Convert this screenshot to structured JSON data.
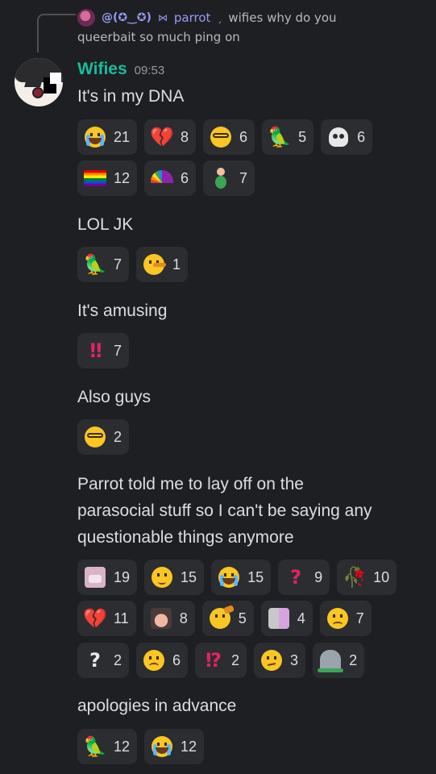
{
  "reply": {
    "author_handle": "@(✪‿✪)",
    "separator": "⋈",
    "second_name": "parrot",
    "comma": "ˏ",
    "preview_text_line1": "wifies why do you",
    "preview_text_line2": "queerbait so much ping on"
  },
  "message": {
    "username": "Wifies",
    "username_color": "#1abc9c",
    "timestamp": "09:53"
  },
  "blocks": [
    {
      "text": "It's in my DNA",
      "reactions": [
        [
          {
            "icon": "sob-emoji",
            "count": "21"
          },
          {
            "icon": "broken-heart-emoji",
            "count": "8"
          },
          {
            "icon": "nerd-face-emoji",
            "count": "6"
          },
          {
            "icon": "parrot-emoji",
            "count": "5"
          },
          {
            "icon": "skull-emoji",
            "count": "6"
          }
        ],
        [
          {
            "icon": "rainbow-flag-emoji",
            "count": "12"
          },
          {
            "icon": "rainbow-emoji",
            "count": "6"
          },
          {
            "icon": "pregnant-person-emoji",
            "count": "7"
          }
        ]
      ]
    },
    {
      "text": "LOL JK",
      "reactions": [
        [
          {
            "icon": "parrot-emoji",
            "count": "7"
          },
          {
            "icon": "lying-face-emoji",
            "count": "1"
          }
        ]
      ]
    },
    {
      "text": "It's amusing",
      "reactions": [
        [
          {
            "icon": "double-exclamation-emoji",
            "count": "7"
          }
        ]
      ]
    },
    {
      "text": "Also guys",
      "reactions": [
        [
          {
            "icon": "nerd-face-emoji",
            "count": "2"
          }
        ]
      ]
    },
    {
      "text_lines": [
        "Parrot told me to lay off on the",
        "parasocial stuff so I can't be saying any",
        "questionable things anymore"
      ],
      "reactions": [
        [
          {
            "icon": "angry-custom-emoji",
            "count": "19"
          },
          {
            "icon": "relieved-face-emoji",
            "count": "15"
          },
          {
            "icon": "sob-emoji",
            "count": "15"
          },
          {
            "icon": "red-question-emoji",
            "count": "9"
          },
          {
            "icon": "wilted-rose-emoji",
            "count": "10"
          }
        ],
        [
          {
            "icon": "broken-heart-emoji",
            "count": "11"
          },
          {
            "icon": "person-custom-emoji",
            "count": "8"
          },
          {
            "icon": "saluting-face-emoji",
            "count": "5"
          },
          {
            "icon": "door-custom-emoji",
            "count": "4"
          },
          {
            "icon": "disappointed-face-emoji",
            "count": "7"
          }
        ],
        [
          {
            "icon": "white-question-emoji",
            "count": "2"
          },
          {
            "icon": "frowning-face-emoji",
            "count": "6"
          },
          {
            "icon": "interrobang-emoji",
            "count": "2"
          },
          {
            "icon": "confused-face-emoji",
            "count": "3"
          },
          {
            "icon": "headstone-emoji",
            "count": "2"
          }
        ]
      ]
    },
    {
      "text": "apologies in advance",
      "reactions": [
        [
          {
            "icon": "parrot-emoji",
            "count": "12"
          },
          {
            "icon": "sob-emoji",
            "count": "12"
          }
        ]
      ]
    }
  ]
}
